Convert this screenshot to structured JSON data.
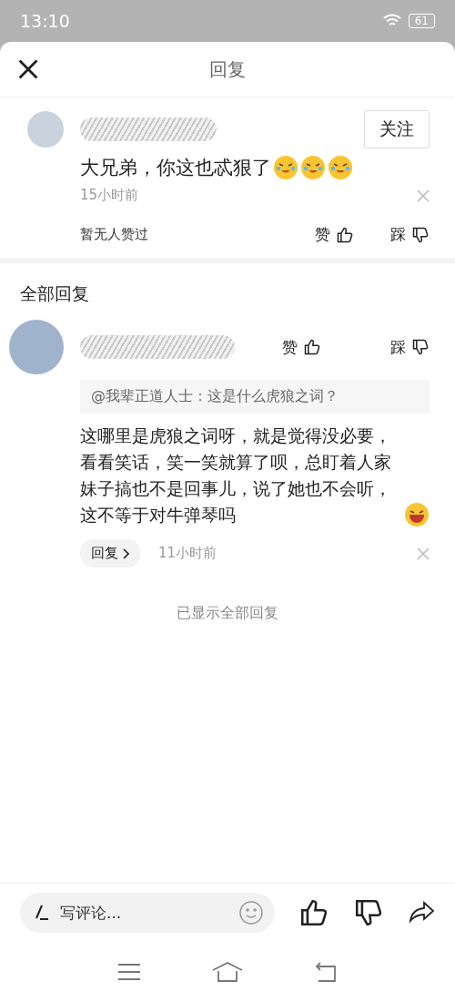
{
  "status_bar": {
    "time": "13:10",
    "battery": "61"
  },
  "header": {
    "title": "回复"
  },
  "comment": {
    "follow_button": "关注",
    "text": "大兄弟，你这也忒狠了",
    "emojis": [
      {
        "kind": "crying_laughing"
      },
      {
        "kind": "crying_laughing"
      },
      {
        "kind": "crying_laughing"
      }
    ],
    "time": "15小时前",
    "likes_summary": "暂无人赞过",
    "like_label": "赞",
    "dislike_label": "踩"
  },
  "replies_heading": "全部回复",
  "replies": [
    {
      "like_label": "赞",
      "dislike_label": "踩",
      "quote": "@我辈正道人士：这是什么虎狼之词？",
      "text": "这哪里是虎狼之词呀，就是觉得没必要，看看笑话，笑一笑就算了呗，总盯着人家妹子搞也不是回事儿，说了她也不会听，这不等于对牛弹琴吗",
      "reply_button": "回复",
      "time": "11小时前"
    }
  ],
  "end_note": "已显示全部回复",
  "bottom_bar": {
    "placeholder": "写评论..."
  }
}
